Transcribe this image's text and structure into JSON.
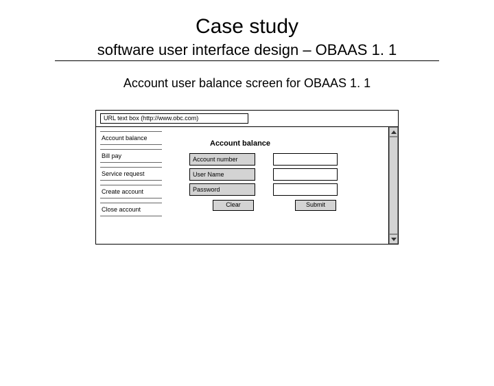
{
  "title": "Case study",
  "subtitle": "software user interface design – OBAAS 1. 1",
  "subtitle2": "Account user balance screen for OBAAS 1. 1",
  "url": "URL text box (http://www.obc.com)",
  "sidebar": {
    "items": [
      {
        "label": "Account balance"
      },
      {
        "label": "Bill pay"
      },
      {
        "label": "Service request"
      },
      {
        "label": "Create account"
      },
      {
        "label": "Close account"
      }
    ]
  },
  "form": {
    "heading": "Account balance",
    "fields": [
      {
        "label": "Account number"
      },
      {
        "label": "User Name"
      },
      {
        "label": "Password"
      }
    ],
    "clear_label": "Clear",
    "submit_label": "Submit"
  }
}
